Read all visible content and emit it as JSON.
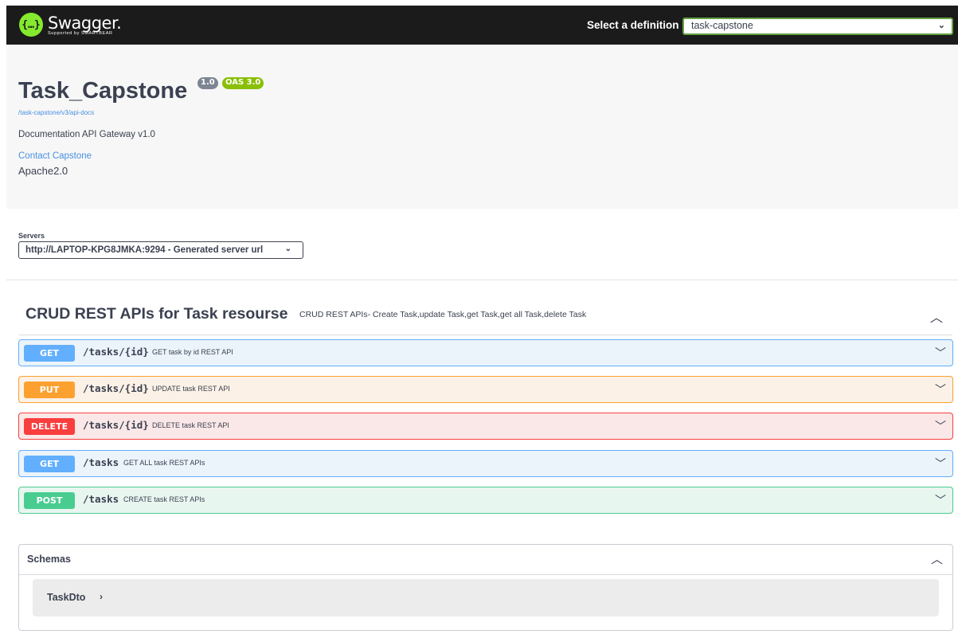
{
  "topbar": {
    "logo_name": "Swagger.",
    "logo_sub": "Supported by SMARTBEAR",
    "definition_label": "Select a definition",
    "definition_value": "task-capstone"
  },
  "info": {
    "title": "Task_Capstone",
    "version_badge": "1.0",
    "oas_badge": "OAS 3.0",
    "api_url": "/task-capstone/v3/api-docs",
    "description": "Documentation API Gateway v1.0",
    "contact": "Contact Capstone",
    "license": "Apache2.0"
  },
  "servers": {
    "label": "Servers",
    "selected": "http://LAPTOP-KPG8JMKA:9294 - Generated server url"
  },
  "tag": {
    "name": "CRUD REST APIs for Task resourse",
    "description": "CRUD REST APIs- Create Task,update Task,get Task,get all Task,delete Task"
  },
  "operations": [
    {
      "method": "GET",
      "path": "/tasks/{id}",
      "summary": "GET task by id REST API"
    },
    {
      "method": "PUT",
      "path": "/tasks/{id}",
      "summary": "UPDATE task REST API"
    },
    {
      "method": "DELETE",
      "path": "/tasks/{id}",
      "summary": "DELETE task REST API"
    },
    {
      "method": "GET",
      "path": "/tasks",
      "summary": "GET ALL task REST APIs"
    },
    {
      "method": "POST",
      "path": "/tasks",
      "summary": "CREATE task REST APIs"
    }
  ],
  "schemas": {
    "title": "Schemas",
    "models": [
      "TaskDto"
    ]
  },
  "icons": {
    "logo": "swagger-logo-icon",
    "dropdown": "chevron-down-icon",
    "collapse": "chevron-up-icon",
    "expand_model": "chevron-right-icon"
  },
  "colors": {
    "topbar": "#1b1b1b",
    "logo": "#85ea2d",
    "get": "#61affe",
    "put": "#fca130",
    "delete": "#f93e3e",
    "post": "#49cc90",
    "link": "#4990e2"
  }
}
